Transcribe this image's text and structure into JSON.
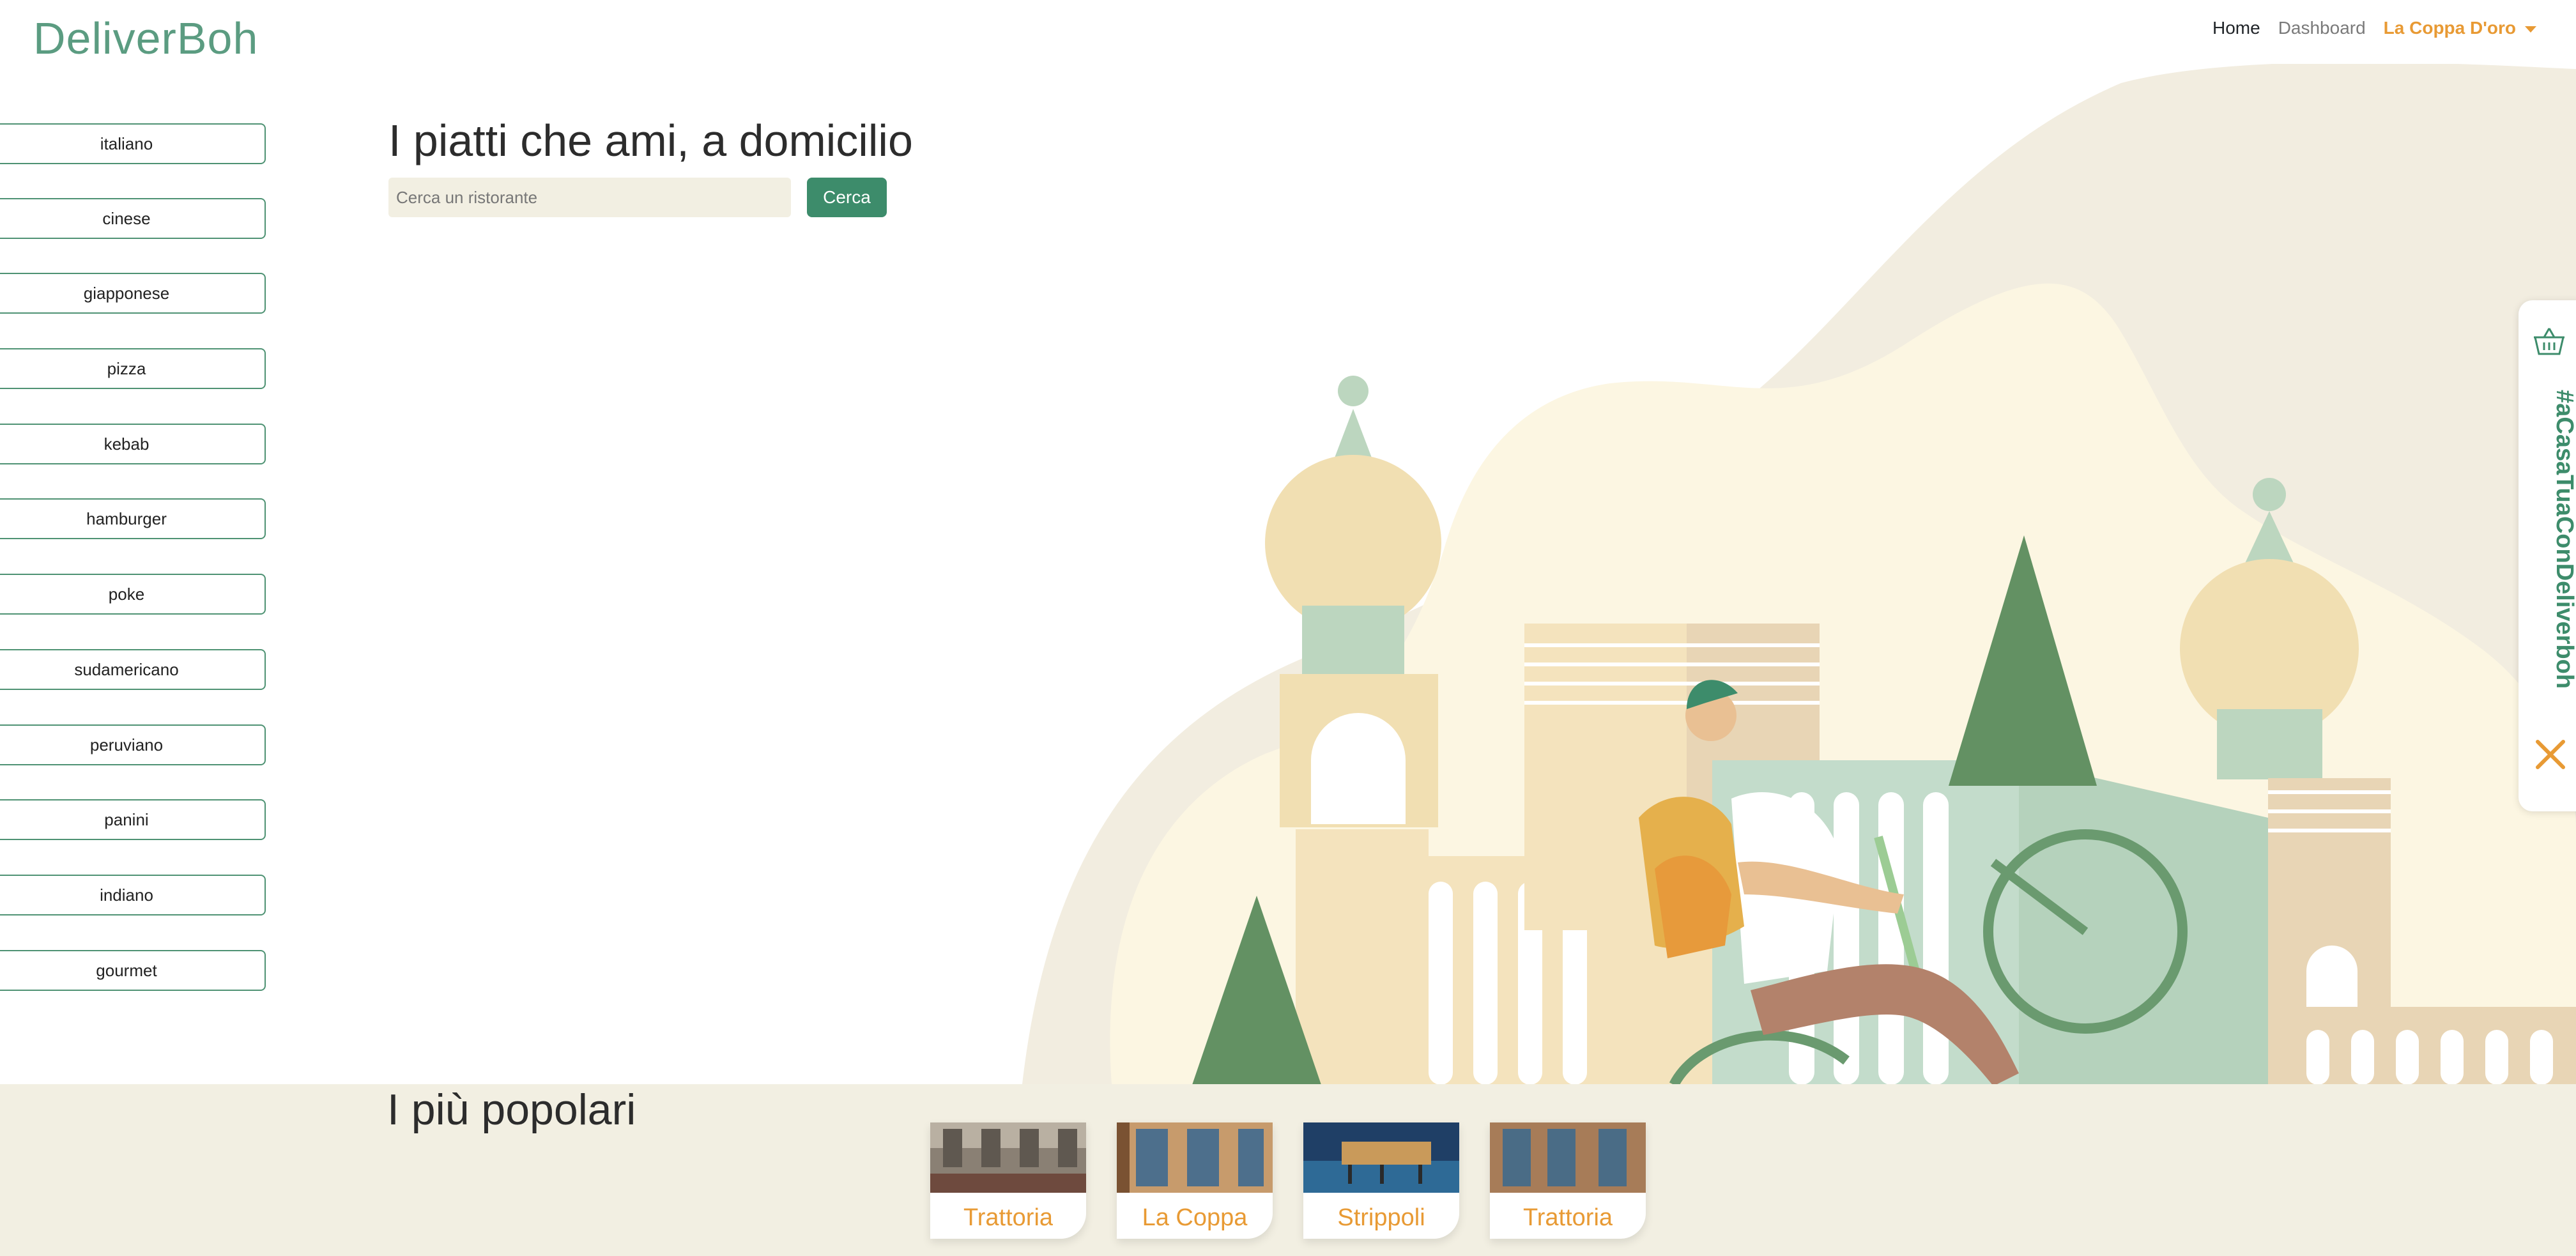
{
  "brand": {
    "logo_text": "DeliverBoh"
  },
  "nav": {
    "home": "Home",
    "dashboard": "Dashboard",
    "user": "La Coppa D'oro"
  },
  "categories": [
    "italiano",
    "cinese",
    "giapponese",
    "pizza",
    "kebab",
    "hamburger",
    "poke",
    "sudamericano",
    "peruviano",
    "panini",
    "indiano",
    "gourmet"
  ],
  "hero": {
    "title": "I piatti che ami, a domicilio",
    "search_placeholder": "Cerca un ristorante",
    "search_button": "Cerca"
  },
  "side_tab": {
    "hashtag": "#aCasaTuaConDeliverboh",
    "icons": [
      "basket-icon",
      "close-icon"
    ]
  },
  "popular": {
    "title": "I più popolari",
    "restaurants": [
      {
        "name": "Trattoria"
      },
      {
        "name": "La Coppa"
      },
      {
        "name": "Strippoli"
      },
      {
        "name": "Trattoria"
      }
    ]
  },
  "colors": {
    "brand_green": "#3d8c6b",
    "accent_orange": "#e89a34",
    "cream": "#f2efe2"
  }
}
